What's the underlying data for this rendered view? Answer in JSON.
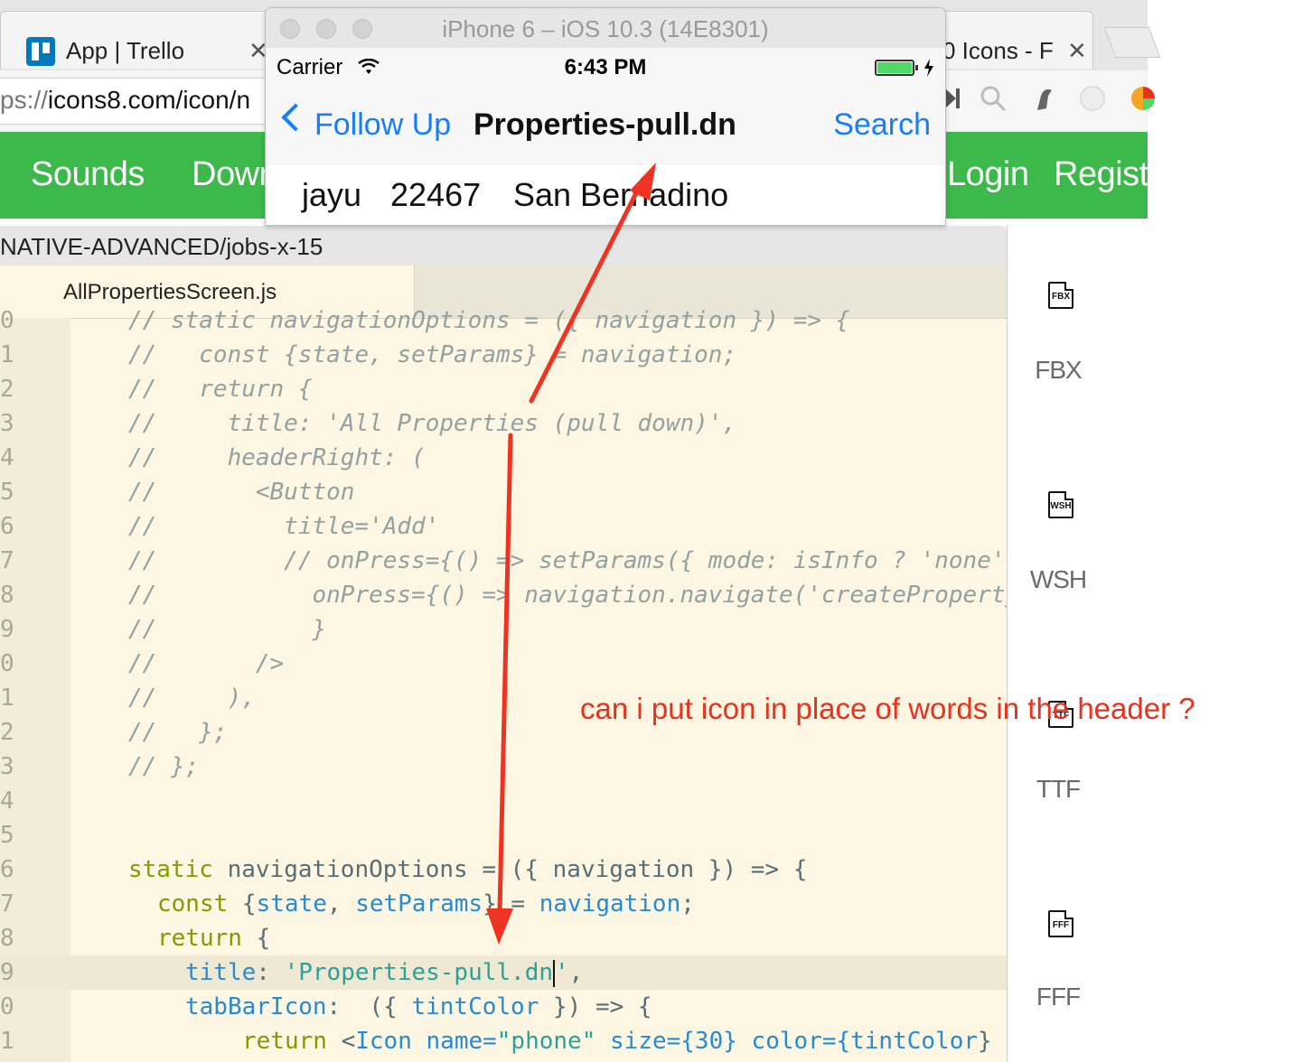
{
  "browser": {
    "tabs": [
      {
        "label": "App | Trello",
        "close": "✕"
      },
      {
        "label": "0 Icons - F",
        "close": "✕"
      }
    ],
    "url": {
      "scheme": "ps://",
      "rest": "icons8.com/icon/n"
    },
    "nav": [
      "Sounds",
      "Down",
      "Login",
      "Registe"
    ],
    "file_icons": [
      {
        "glyph": "FBX",
        "label": "FBX"
      },
      {
        "glyph": "WSH",
        "label": "WSH"
      },
      {
        "glyph": "TTF",
        "label": "TTF"
      },
      {
        "glyph": "FFF",
        "label": "FFF"
      }
    ]
  },
  "simulator": {
    "title": "iPhone 6 – iOS 10.3 (14E8301)",
    "carrier": "Carrier",
    "time": "6:43 PM",
    "battery_level": 1.0,
    "back_label": "Follow Up",
    "nav_title": "Properties-pull.dn",
    "right_button": "Search",
    "row": {
      "name": "jayu",
      "zip": "22467",
      "city": "San Bernadino"
    }
  },
  "editor": {
    "path": "NATIVE-ADVANCED/jobs-x-15",
    "tab": "AllPropertiesScreen.js",
    "line_numbers": [
      "0",
      "1",
      "2",
      "3",
      "4",
      "5",
      "6",
      "7",
      "8",
      "9",
      "0",
      "1",
      "2",
      "3",
      "4",
      "5",
      "6",
      "7",
      "8",
      "9",
      "0",
      "1"
    ],
    "comment_lines": [
      "// static navigationOptions = ({ navigation }) => {",
      "//   const {state, setParams} = navigation;",
      "//   return {",
      "//     title: 'All Properties (pull down)',",
      "//     headerRight: (",
      "//       <Button",
      "//         title='Add'",
      "//         // onPress={() => setParams({ mode: isInfo ? 'none'",
      "//           onPress={() => navigation.navigate('createProperty",
      "//           }",
      "//       />",
      "//     ),",
      "//   };",
      "// };",
      "",
      ""
    ],
    "code_lines": {
      "l16": {
        "k": "static",
        "rest": " navigationOptions = ({ navigation }) => {"
      },
      "l17": {
        "k": "const",
        "a": " {",
        "v1": "state",
        "b": ", ",
        "v2": "setParams",
        "c": "} = ",
        "v3": "navigation",
        "d": ";"
      },
      "l18": {
        "k": "return",
        "rest": " {"
      },
      "l19": {
        "v": "title",
        "a": ": ",
        "s": "'Properties-pull.dn",
        "s2": "'",
        "b": ","
      },
      "l20": {
        "v": "tabBarIcon",
        "a": ":  ({ ",
        "v2": "tintColor",
        "b": " }) => {"
      },
      "l21": {
        "k": "return",
        "a": " <",
        "v": "Icon",
        "b": " name=",
        "s": "\"phone\"",
        "c": " size={30} color={",
        "v2": "tintColor",
        "d": "} ."
      }
    }
  },
  "annotation": {
    "text": "can i put icon in place of words in the header ?",
    "color": "#e8321c"
  }
}
